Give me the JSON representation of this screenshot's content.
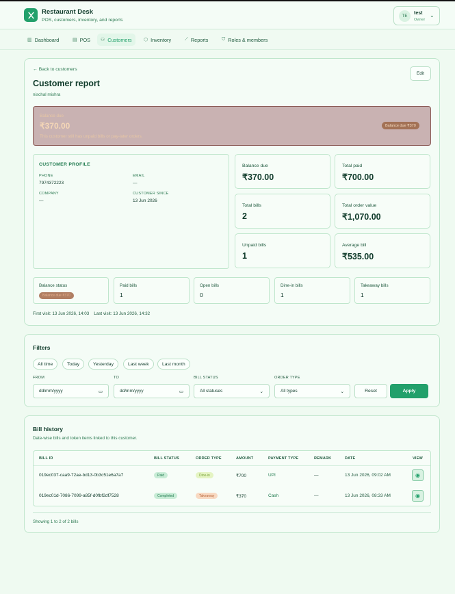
{
  "app": {
    "title": "Restaurant Desk",
    "subtitle": "POS, customers, inventory, and reports",
    "logo_icon": "utensils-icon",
    "user": {
      "initials": "TE",
      "name": "test",
      "role": "Owner"
    }
  },
  "nav": [
    {
      "label": "Dashboard",
      "icon": "chart-icon",
      "active": false
    },
    {
      "label": "POS",
      "icon": "register-icon",
      "active": false
    },
    {
      "label": "Customers",
      "icon": "users-icon",
      "active": true
    },
    {
      "label": "Inventory",
      "icon": "box-icon",
      "active": false
    },
    {
      "label": "Reports",
      "icon": "line-chart-icon",
      "active": false
    },
    {
      "label": "Roles & members",
      "icon": "shield-icon",
      "active": false
    }
  ],
  "report": {
    "back_label": "Back to customers",
    "edit_label": "Edit",
    "title": "Customer report",
    "customer_name": "nischal mishra",
    "alert": {
      "label": "Balance due",
      "amount": "₹370.00",
      "note": "This customer still has unpaid bills or pay-later orders.",
      "badge": "Balance due ₹370"
    },
    "profile": {
      "heading": "CUSTOMER PROFILE",
      "phone_label": "PHONE",
      "phone": "7974372223",
      "email_label": "EMAIL",
      "email": "—",
      "company_label": "COMPANY",
      "company": "—",
      "since_label": "CUSTOMER SINCE",
      "since": "13 Jun 2026"
    },
    "stats": [
      {
        "label": "Balance due",
        "value": "₹370.00"
      },
      {
        "label": "Total paid",
        "value": "₹700.00"
      },
      {
        "label": "Total bills",
        "value": "2"
      },
      {
        "label": "Total order value",
        "value": "₹1,070.00"
      },
      {
        "label": "Unpaid bills",
        "value": "1"
      },
      {
        "label": "Average bill",
        "value": "₹535.00"
      }
    ],
    "mini": {
      "balance_status_label": "Balance status",
      "balance_status_badge": "Balance due ₹370",
      "paid_label": "Paid bills",
      "paid": "1",
      "open_label": "Open bills",
      "open": "0",
      "dinein_label": "Dine-in bills",
      "dinein": "1",
      "takeaway_label": "Takeaway bills",
      "takeaway": "1"
    },
    "visits": "First visit: 13 Jun 2026, 14:03    Last visit: 13 Jun 2026, 14:32"
  },
  "filters": {
    "title": "Filters",
    "chips": [
      "All time",
      "Today",
      "Yesterday",
      "Last week",
      "Last month"
    ],
    "from_label": "FROM",
    "from_value": "dd/mm/yyyy",
    "to_label": "TO",
    "to_value": "dd/mm/yyyy",
    "status_label": "BILL STATUS",
    "status_value": "All statuses",
    "type_label": "ORDER TYPE",
    "type_value": "All types",
    "reset_label": "Reset",
    "apply_label": "Apply"
  },
  "bills": {
    "title": "Bill history",
    "subtitle": "Date-wise bills and token items linked to this customer.",
    "headers": [
      "BILL ID",
      "BILL STATUS",
      "ORDER TYPE",
      "AMOUNT",
      "PAYMENT TYPE",
      "REMARK",
      "DATE",
      "VIEW"
    ],
    "rows": [
      {
        "id": "019ec037-caa9-72ae-bd13-0b3c51e6a7a7",
        "status": "Paid",
        "type": "Dine-in",
        "amount": "₹700",
        "payment": "UPI",
        "remark": "—",
        "date": "13 Jun 2026, 09:02 AM"
      },
      {
        "id": "019ec01d-7086-7099-a85f-d0fbf2df7528",
        "status": "Completed",
        "type": "Takeaway",
        "amount": "₹370",
        "payment": "Cash",
        "remark": "—",
        "date": "13 Jun 2026, 08:33 AM"
      }
    ],
    "showing": "Showing 1 to 2 of 2 bills"
  },
  "colors": {
    "accent": "#22a06b",
    "background": "#effaf1",
    "alert_bg": "#c9b2b2"
  }
}
